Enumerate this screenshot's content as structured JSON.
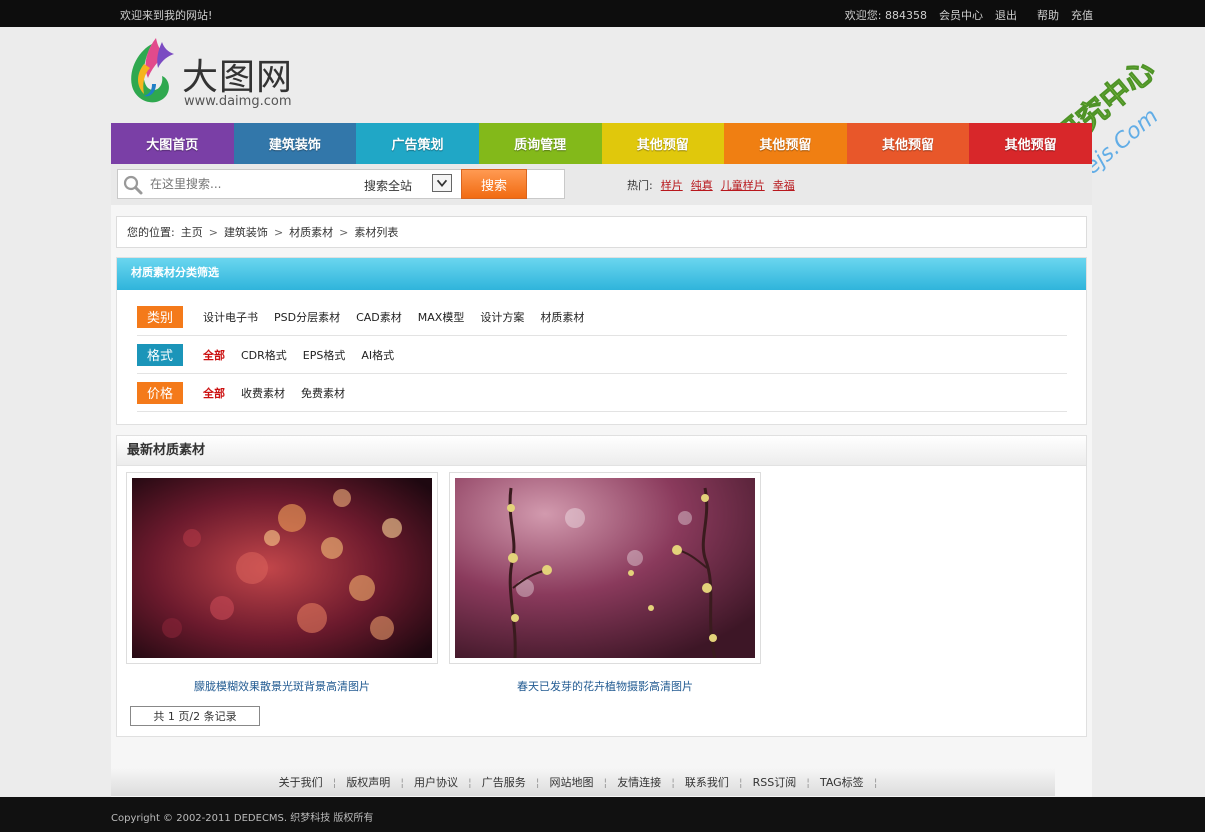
{
  "topbar": {
    "welcome": "欢迎来到我的网站!",
    "user_greeting": "欢迎您: 884358",
    "member_center": "会员中心",
    "logout": "退出",
    "help": "帮助",
    "recharge": "充值"
  },
  "logo": {
    "name": "大图网",
    "url": "www.daimg.com"
  },
  "nav": [
    {
      "label": "大图首页",
      "color": "#7a3fa6"
    },
    {
      "label": "建筑装饰",
      "color": "#3277aa"
    },
    {
      "label": "广告策划",
      "color": "#20a7c6"
    },
    {
      "label": "质询管理",
      "color": "#83b91a"
    },
    {
      "label": "其他预留",
      "color": "#e0c80c"
    },
    {
      "label": "其他预留",
      "color": "#f07f12"
    },
    {
      "label": "其他预留",
      "color": "#e8572a"
    },
    {
      "label": "其他预留",
      "color": "#d8272a"
    }
  ],
  "search": {
    "placeholder": "在这里搜索...",
    "scope": "搜索全站",
    "button": "搜索",
    "hot_label": "热门:",
    "hot_links": [
      "样片",
      "纯真",
      "儿童样片",
      "幸福"
    ]
  },
  "breadcrumb": {
    "prefix": "您的位置:",
    "items": [
      "主页",
      "建筑装饰",
      "材质素材",
      "素材列表"
    ]
  },
  "filter": {
    "title": "材质素材分类筛选",
    "rows": [
      {
        "tag": "类别",
        "tag_color": "#f47a1a",
        "options": [
          "设计电子书",
          "PSD分层素材",
          "CAD素材",
          "MAX模型",
          "设计方案",
          "材质素材"
        ]
      },
      {
        "tag": "格式",
        "tag_color": "#1b95b9",
        "options": [
          "全部",
          "CDR格式",
          "EPS格式",
          "AI格式"
        ]
      },
      {
        "tag": "价格",
        "tag_color": "#f47a1a",
        "options": [
          "全部",
          "收费素材",
          "免费素材"
        ]
      }
    ]
  },
  "latest": {
    "title": "最新材质素材",
    "items": [
      {
        "caption": "朦胧模糊效果散景光斑背景高清图片"
      },
      {
        "caption": "春天已发芽的花卉植物摄影高清图片"
      }
    ],
    "pager": "共 1 页/2 条记录"
  },
  "footer": {
    "links": [
      "关于我们",
      "版权声明",
      "用户协议",
      "广告服务",
      "网站地图",
      "友情连接",
      "联系我们",
      "RSS订阅",
      "TAG标签"
    ],
    "copyright": "Copyright © 2002-2011 DEDECMS. 织梦科技 版权所有"
  },
  "watermark": {
    "text_cn": "织梦技术研究中心",
    "text_en": "Www.dedejs.Com"
  }
}
